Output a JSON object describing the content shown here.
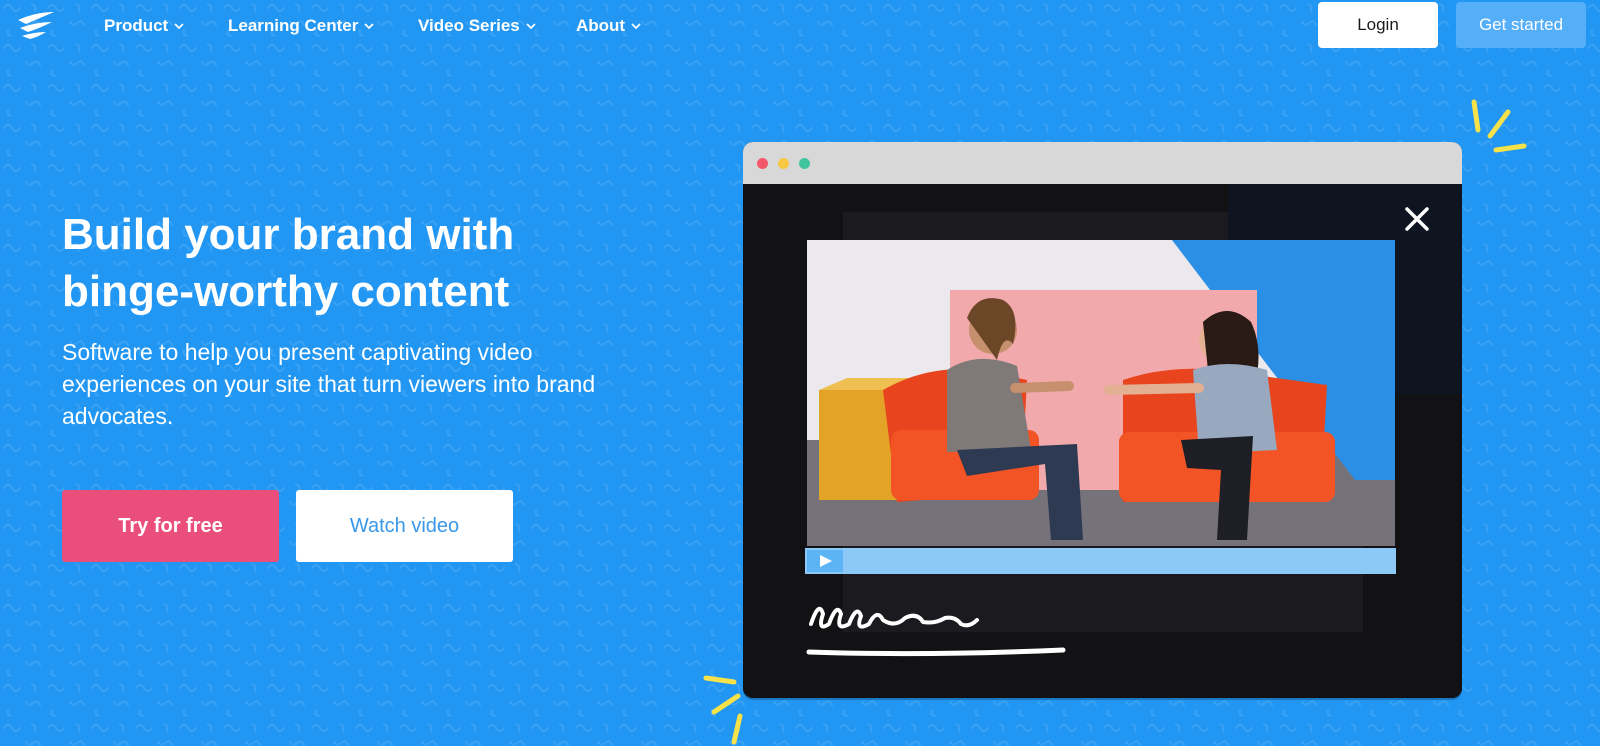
{
  "nav": {
    "logo_icon": "brand-logo-icon",
    "items": [
      {
        "label": "Product"
      },
      {
        "label": "Learning Center"
      },
      {
        "label": "Video Series"
      },
      {
        "label": "About"
      }
    ],
    "login_label": "Login",
    "get_started_label": "Get started"
  },
  "hero": {
    "title_line1": "Build your brand with",
    "title_line2": "binge-worthy content",
    "subtitle": "Software to help you present captivating video experiences on your site that turn viewers into brand advocates.",
    "try_label": "Try for free",
    "watch_label": "Watch video"
  },
  "video_window": {
    "close_icon": "close-icon",
    "play_icon": "play-icon",
    "progress": 0.0
  },
  "colors": {
    "background": "#2196f3",
    "try_button": "#ea4f7c",
    "watch_text": "#3a98e9",
    "get_started": "#54aef8",
    "progress_bar": "#8dc9f6",
    "spark": "#f7e24a"
  }
}
